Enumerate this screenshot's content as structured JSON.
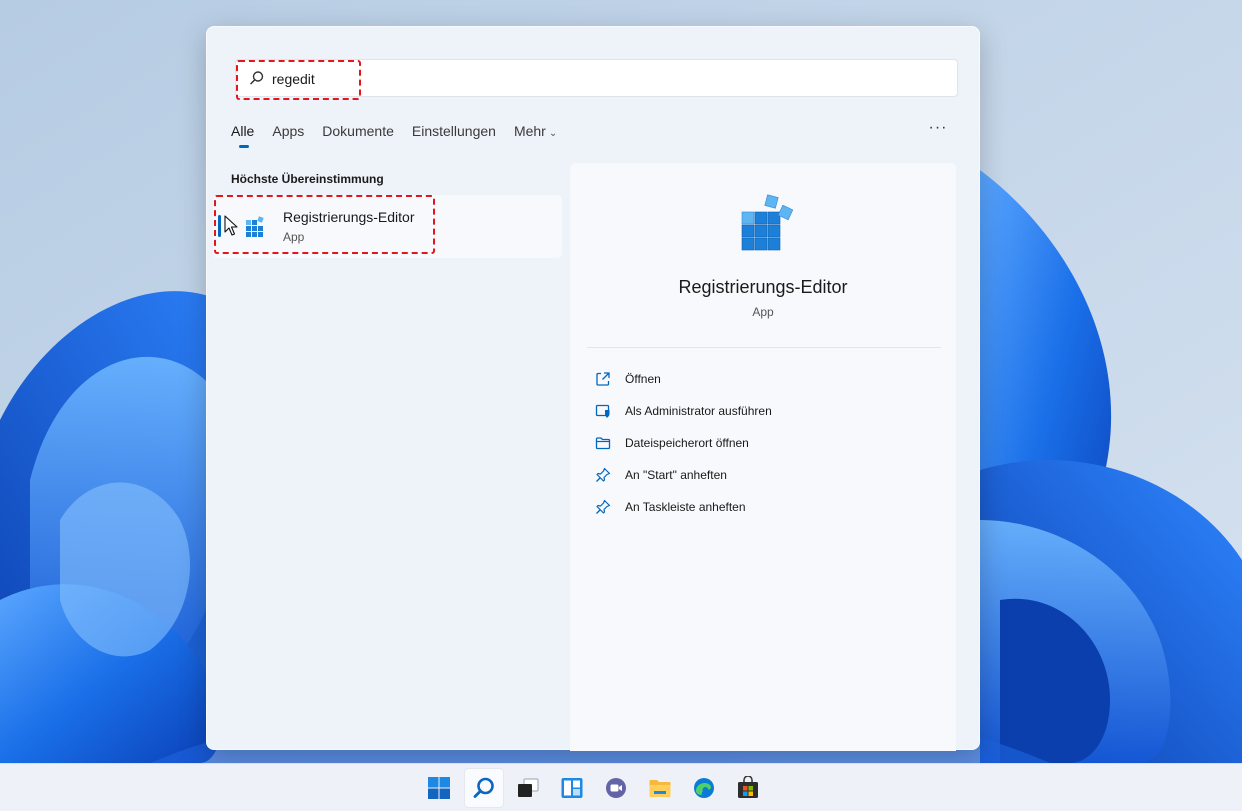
{
  "search": {
    "query": "regedit",
    "placeholder": ""
  },
  "tabs": [
    {
      "label": "Alle",
      "active": true
    },
    {
      "label": "Apps",
      "active": false
    },
    {
      "label": "Dokumente",
      "active": false
    },
    {
      "label": "Einstellungen",
      "active": false
    },
    {
      "label": "Mehr",
      "active": false,
      "has_dropdown": true
    }
  ],
  "more_menu_label": "···",
  "best_match": {
    "section_title": "Höchste Übereinstimmung",
    "title": "Registrierungs-Editor",
    "subtitle": "App",
    "icon": "registry-editor-icon"
  },
  "detail": {
    "title": "Registrierungs-Editor",
    "subtitle": "App",
    "icon": "registry-editor-icon",
    "actions": [
      {
        "label": "Öffnen",
        "icon": "open-external-icon"
      },
      {
        "label": "Als Administrator ausführen",
        "icon": "admin-shield-icon"
      },
      {
        "label": "Dateispeicherort öffnen",
        "icon": "folder-icon"
      },
      {
        "label": "An \"Start\" anheften",
        "icon": "pin-icon"
      },
      {
        "label": "An Taskleiste anheften",
        "icon": "pin-icon"
      }
    ]
  },
  "taskbar": {
    "items": [
      {
        "name": "start",
        "icon": "windows-start-icon",
        "active": false
      },
      {
        "name": "search",
        "icon": "search-icon",
        "active": true
      },
      {
        "name": "task-view",
        "icon": "task-view-icon",
        "active": false
      },
      {
        "name": "widgets",
        "icon": "widgets-icon",
        "active": false
      },
      {
        "name": "teams-chat",
        "icon": "teams-chat-icon",
        "active": false
      },
      {
        "name": "file-explorer",
        "icon": "file-explorer-icon",
        "active": false
      },
      {
        "name": "edge",
        "icon": "edge-browser-icon",
        "active": false
      },
      {
        "name": "store",
        "icon": "microsoft-store-icon",
        "active": false
      }
    ]
  },
  "colors": {
    "accent": "#0067c0",
    "highlight_annotation": "#e3151d"
  }
}
